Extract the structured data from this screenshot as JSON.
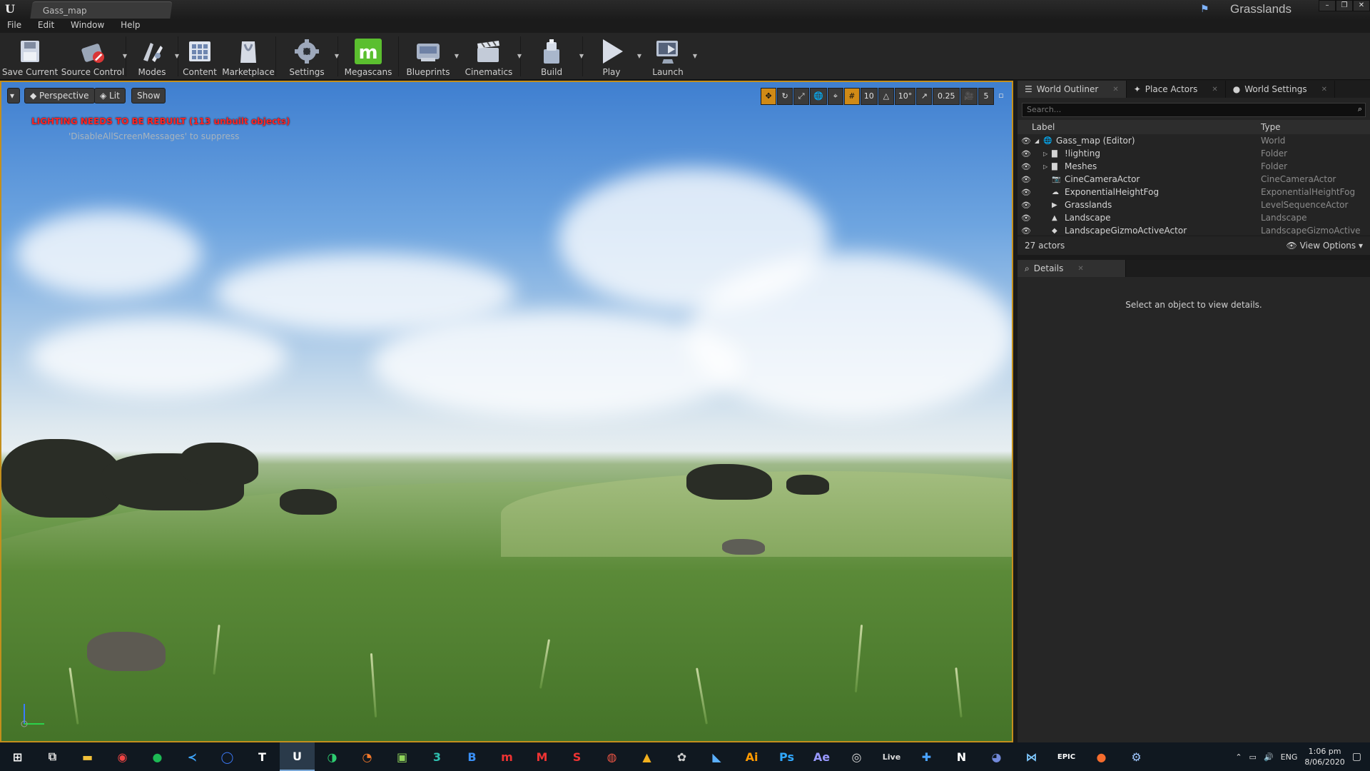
{
  "app": {
    "doc_tab": "Gass_map",
    "project_name": "Grasslands",
    "window_controls": [
      "minimize",
      "restore",
      "close"
    ]
  },
  "menu": [
    "File",
    "Edit",
    "Window",
    "Help"
  ],
  "toolbar": [
    {
      "label": "Save Current",
      "icon": "save-icon",
      "dropdown": false
    },
    {
      "label": "Source Control",
      "icon": "source-control-icon",
      "dropdown": true
    },
    {
      "label": "Modes",
      "icon": "modes-icon",
      "dropdown": true
    },
    {
      "label": "Content",
      "icon": "content-icon",
      "dropdown": false
    },
    {
      "label": "Marketplace",
      "icon": "marketplace-icon",
      "dropdown": false
    },
    {
      "label": "Settings",
      "icon": "settings-icon",
      "dropdown": true
    },
    {
      "label": "Megascans",
      "icon": "megascans-icon",
      "dropdown": false
    },
    {
      "label": "Blueprints",
      "icon": "blueprints-icon",
      "dropdown": true
    },
    {
      "label": "Cinematics",
      "icon": "cinematics-icon",
      "dropdown": true
    },
    {
      "label": "Build",
      "icon": "build-icon",
      "dropdown": true
    },
    {
      "label": "Play",
      "icon": "play-icon",
      "dropdown": true
    },
    {
      "label": "Launch",
      "icon": "launch-icon",
      "dropdown": true
    }
  ],
  "viewport": {
    "view_mode": "Perspective",
    "lighting": "Lit",
    "show": "Show",
    "grid_snap": "10",
    "rotation_snap": "10°",
    "scale_snap": "0.25",
    "camera_speed": "5",
    "warning": "LIGHTING NEEDS TO BE REBUILT (113 unbuilt objects)",
    "warning_sub": "'DisableAllScreenMessages' to suppress"
  },
  "outliner": {
    "tabs": [
      "World Outliner",
      "Place Actors",
      "World Settings"
    ],
    "search_placeholder": "Search...",
    "col_label": "Label",
    "col_type": "Type",
    "rows": [
      {
        "label": "Gass_map (Editor)",
        "type": "World",
        "indent": 0,
        "icon": "world-icon"
      },
      {
        "label": "!lighting",
        "type": "Folder",
        "indent": 1,
        "icon": "folder-icon"
      },
      {
        "label": "Meshes",
        "type": "Folder",
        "indent": 1,
        "icon": "folder-icon"
      },
      {
        "label": "CineCameraActor",
        "type": "CineCameraActor",
        "indent": 1,
        "icon": "camera-icon"
      },
      {
        "label": "ExponentialHeightFog",
        "type": "ExponentialHeightFog",
        "indent": 1,
        "icon": "fog-icon"
      },
      {
        "label": "Grasslands",
        "type": "LevelSequenceActor",
        "indent": 1,
        "icon": "sequence-icon"
      },
      {
        "label": "Landscape",
        "type": "Landscape",
        "indent": 1,
        "icon": "landscape-icon"
      },
      {
        "label": "LandscapeGizmoActiveActor",
        "type": "LandscapeGizmoActive",
        "indent": 1,
        "icon": "gizmo-icon"
      }
    ],
    "actor_count": "27 actors",
    "view_options": "View Options"
  },
  "details": {
    "tab": "Details",
    "empty_text": "Select an object to view details."
  },
  "taskbar": {
    "apps": [
      "start",
      "task-view",
      "file-explorer",
      "chrome",
      "spotify",
      "vscode",
      "signal",
      "typora",
      "unreal",
      "app-green",
      "blender",
      "maps",
      "3",
      "b",
      "m-red",
      "m-red2",
      "s-red",
      "toggl",
      "triangle",
      "davinci",
      "app-blue",
      "illustrator",
      "photoshop",
      "after-effects",
      "obs",
      "live",
      "app-dark",
      "notion",
      "discord",
      "vs",
      "epic",
      "origin",
      "steam"
    ],
    "language": "ENG",
    "time": "1:06 pm",
    "date": "8/06/2020"
  }
}
